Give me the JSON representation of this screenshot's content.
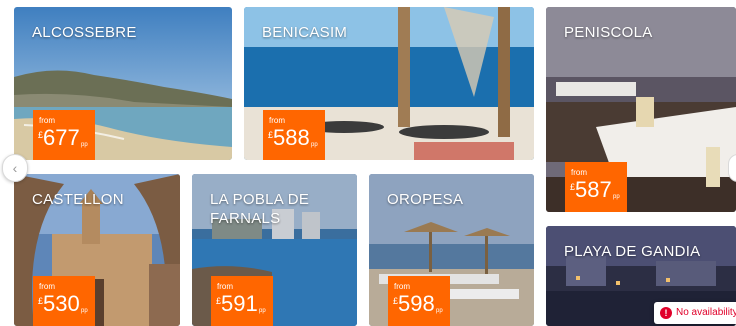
{
  "price_prefix": "from",
  "currency": "£",
  "price_suffix": "pp",
  "carousel": {
    "prev_symbol": "‹"
  },
  "tiles": [
    {
      "name": "ALCOSSEBRE",
      "price": "677"
    },
    {
      "name": "BENICASIM",
      "price": "588"
    },
    {
      "name": "PENISCOLA",
      "price": "587"
    },
    {
      "name": "CASTELLON",
      "price": "530"
    },
    {
      "name": "LA POBLA DE\nFARNALS",
      "price": "591"
    },
    {
      "name": "OROPESA",
      "price": "598"
    },
    {
      "name": "PLAYA DE GANDIA",
      "price": ""
    }
  ],
  "availability_notice": {
    "text": "No availability",
    "icon": "alert-icon"
  },
  "colors": {
    "price_tag": "#ff6600",
    "alert": "#e0002a"
  }
}
